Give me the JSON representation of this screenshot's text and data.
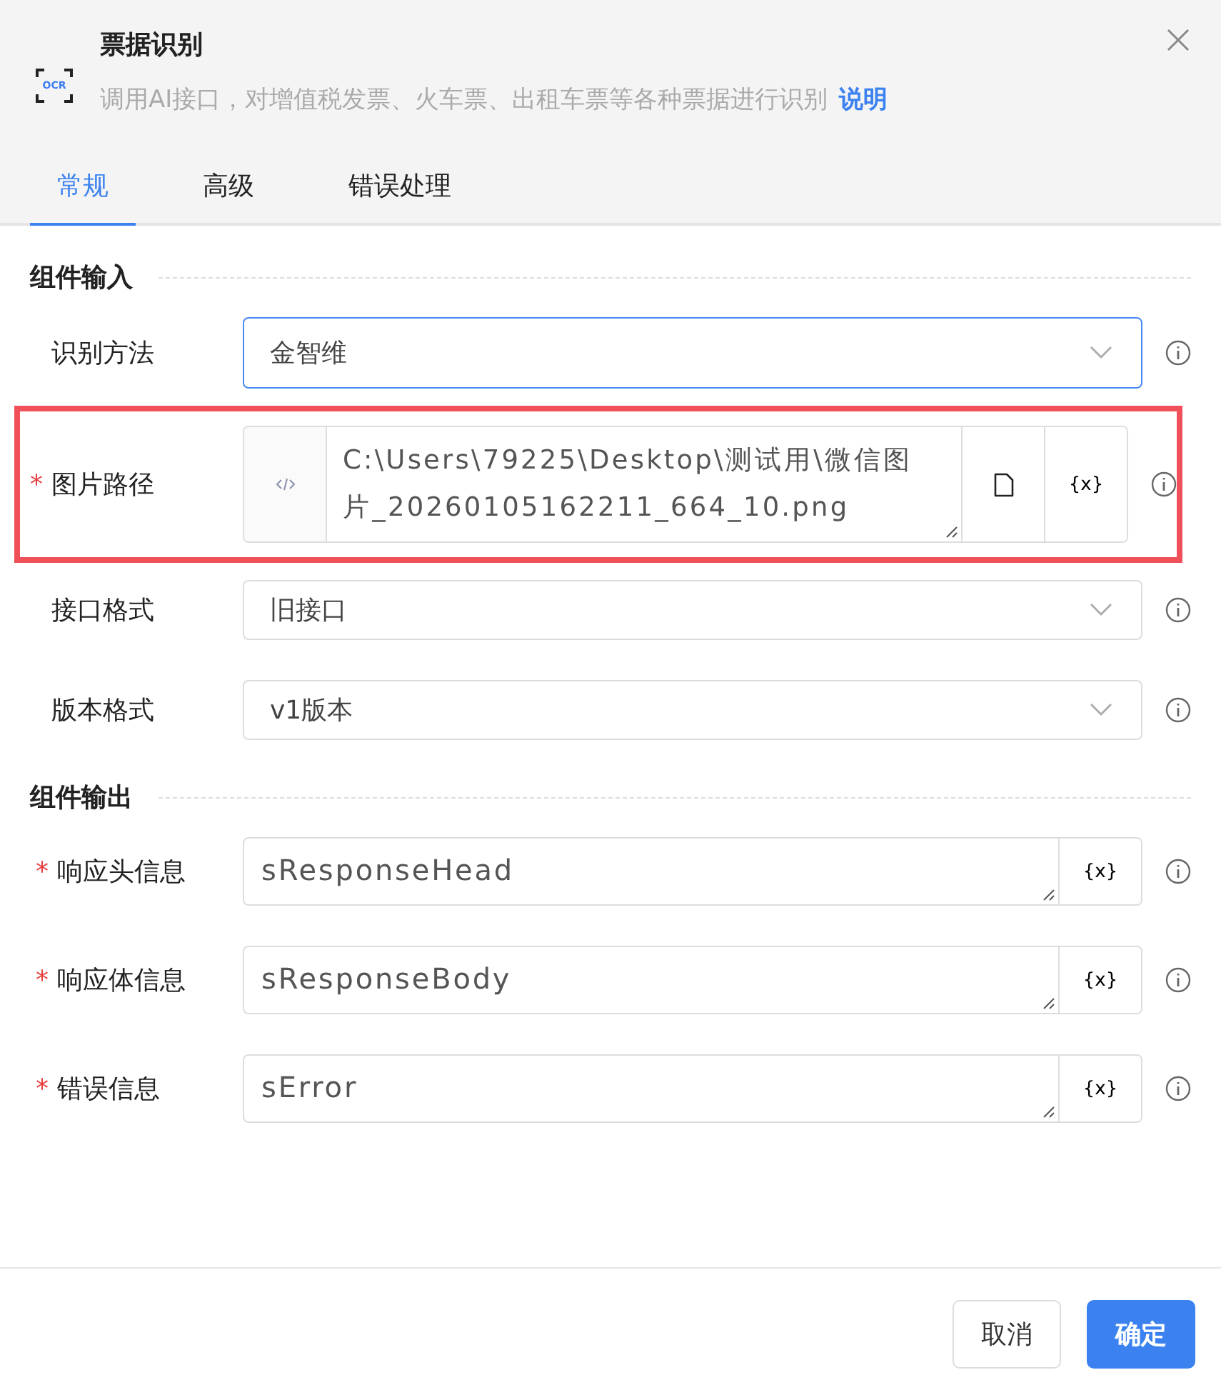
{
  "header": {
    "icon_label": "OCR",
    "title": "票据识别",
    "description": "调用AI接口，对增值税发票、火车票、出租车票等各种票据进行识别",
    "help_link": "说明"
  },
  "tabs": [
    {
      "label": "常规",
      "selected": true
    },
    {
      "label": "高级",
      "selected": false
    },
    {
      "label": "错误处理",
      "selected": false
    }
  ],
  "sections": [
    {
      "title": "组件输入",
      "rows": [
        {
          "kind": "select",
          "label": "识别方法",
          "value": "金智维",
          "focused": true,
          "highlighted": false
        },
        {
          "kind": "path",
          "label": "图片路径",
          "required_mark": "*",
          "value": "C:\\Users\\79225\\Desktop\\测试用\\微信图片_20260105162211_664_10.png",
          "variable_label": "{x}",
          "highlighted": true
        },
        {
          "kind": "select",
          "label": "接口格式",
          "value": "旧接口",
          "focused": false,
          "highlighted": false
        },
        {
          "kind": "select",
          "label": "版本格式",
          "value": "v1版本",
          "focused": false,
          "highlighted": false
        }
      ]
    },
    {
      "title": "组件输出",
      "rows": [
        {
          "kind": "text",
          "label": "响应头信息",
          "required_mark": "*",
          "value": "sResponseHead",
          "variable_label": "{x}",
          "highlighted": false
        },
        {
          "kind": "text",
          "label": "响应体信息",
          "required_mark": "*",
          "value": "sResponseBody",
          "variable_label": "{x}",
          "highlighted": false
        },
        {
          "kind": "text",
          "label": "错误信息",
          "required_mark": "*",
          "value": "sError",
          "variable_label": "{x}",
          "highlighted": false
        }
      ]
    }
  ],
  "buttons": [
    {
      "label": "取消",
      "kind": "secondary"
    },
    {
      "label": "确定",
      "kind": "primary"
    }
  ]
}
